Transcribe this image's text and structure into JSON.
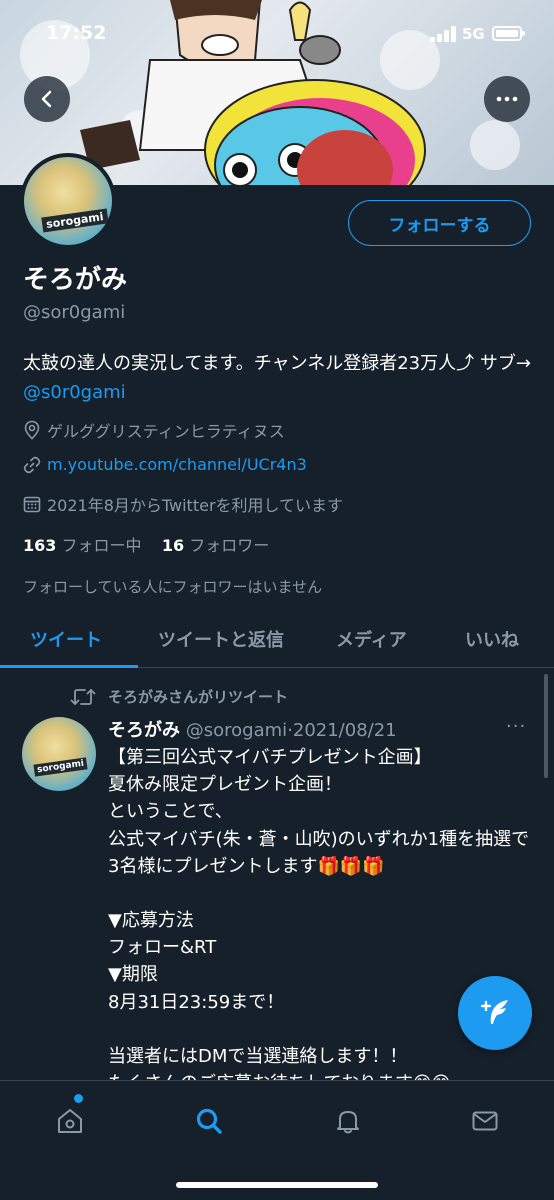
{
  "status_bar": {
    "time": "17:52",
    "network": "5G"
  },
  "profile": {
    "name": "そろがみ",
    "handle": "@sor0gami",
    "avatar_tag": "sorogami",
    "follow_button": "フォローする",
    "bio_text": "太鼓の達人の実況してます。チャンネル登録者23万人⤴︎ サブ→ ",
    "bio_link": "@s0r0gami",
    "location": "ゲルググリスティンヒラティヌス",
    "website": "m.youtube.com/channel/UCr4n3",
    "joined": "2021年8月からTwitterを利用しています",
    "following_count": "163",
    "following_label": "フォロー中",
    "followers_count": "16",
    "followers_label": "フォロワー",
    "no_mutual": "フォローしている人にフォロワーはいません"
  },
  "tabs": [
    {
      "label": "ツイート",
      "active": true
    },
    {
      "label": "ツイートと返信",
      "active": false
    },
    {
      "label": "メディア",
      "active": false
    },
    {
      "label": "いいね",
      "active": false
    }
  ],
  "tweet": {
    "retweet_label": "そろがみさんがリツイート",
    "author_name": "そろがみ",
    "author_handle": "@sorogami",
    "date": "2021/08/21",
    "more": "···",
    "lines": [
      "【第三回公式マイバチプレゼント企画】",
      "夏休み限定プレゼント企画！",
      "ということで、",
      "公式マイバチ(朱・蒼・山吹)のいずれか1種を抽選で3名様にプレゼントします🎁🎁🎁",
      "",
      "▼応募方法",
      "フォロー&RT",
      "▼期限",
      "8月31日23:59まで！",
      "",
      "当選者にはDMで当選連絡します！！",
      "たくさんのご応募お待ちしております😊😊"
    ]
  },
  "colors": {
    "background": "#15202b",
    "accent": "#1d9bf0",
    "muted": "#8b98a5",
    "divider": "#38444d"
  },
  "icons": [
    "back-arrow-icon",
    "more-icon",
    "location-icon",
    "link-icon",
    "calendar-icon",
    "retweet-icon",
    "compose-tweet-icon",
    "home-icon",
    "search-icon",
    "notifications-icon",
    "messages-icon"
  ]
}
